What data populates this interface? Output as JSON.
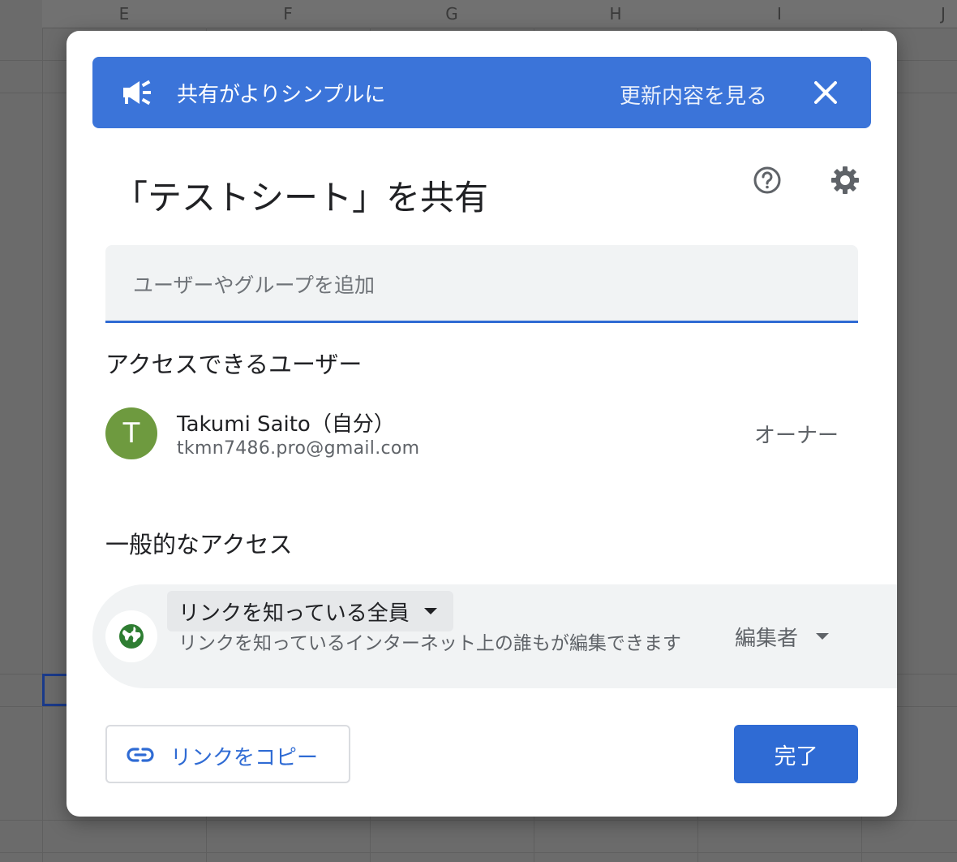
{
  "sheet": {
    "columns": [
      "E",
      "F",
      "G",
      "H",
      "I",
      "J"
    ]
  },
  "banner": {
    "title": "共有がよりシンプルに",
    "link": "更新内容を見る",
    "icon": "megaphone-icon",
    "close_icon": "close-icon"
  },
  "dialog": {
    "title": "「テストシート」を共有",
    "help_icon": "help-icon",
    "settings_icon": "gear-icon"
  },
  "add_people": {
    "placeholder": "ユーザーやグループを追加"
  },
  "people_section": {
    "heading": "アクセスできるユーザー",
    "users": [
      {
        "avatar_letter": "T",
        "name": "Takumi Saito",
        "self_label": "（自分）",
        "email": "tkmn7486.pro@gmail.com",
        "role": "オーナー"
      }
    ]
  },
  "general_access": {
    "heading": "一般的なアクセス",
    "scope": "リンクを知っている全員",
    "description": "リンクを知っているインターネット上の誰もが編集できます",
    "role": "編集者",
    "icon": "globe-icon"
  },
  "footer": {
    "copy_link_label": "リンクをコピー",
    "done_label": "完了",
    "link_icon": "link-icon"
  },
  "colors": {
    "banner": "#3b74d9",
    "primary": "#2f6bd4",
    "avatar": "#6e9a3f",
    "globe": "#2e7d32"
  }
}
